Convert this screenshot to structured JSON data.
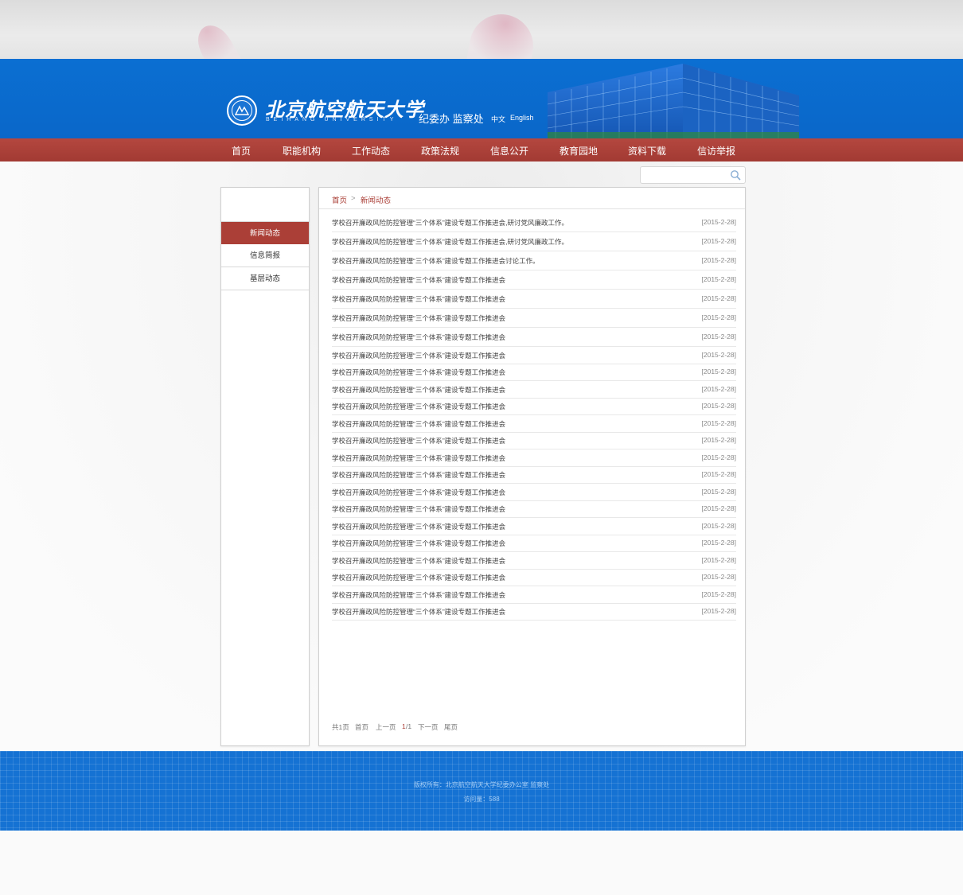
{
  "header": {
    "university_cn": "北京航空航天大学",
    "university_en": "BEIHANG UNIVERSITY",
    "org_name": "纪委办 监察处",
    "lang_cn": "中文",
    "lang_en": "English"
  },
  "nav": {
    "items": [
      "首页",
      "职能机构",
      "工作动态",
      "政策法规",
      "信息公开",
      "教育园地",
      "资料下载",
      "信访举报"
    ]
  },
  "search": {
    "placeholder": "",
    "icon": "search-icon"
  },
  "sidebar": {
    "items": [
      {
        "label": "新闻动态",
        "active": true
      },
      {
        "label": "信息简报",
        "active": false
      },
      {
        "label": "基层动态",
        "active": false
      }
    ]
  },
  "breadcrumb": {
    "home": "首页",
    "sep": ">",
    "current": "新闻动态"
  },
  "news": [
    {
      "title": "学校召开廉政风险防控管理“三个体系”建设专题工作推进会,研讨党风廉政工作。",
      "date": "[2015-2-28]"
    },
    {
      "title": "学校召开廉政风险防控管理“三个体系”建设专题工作推进会,研讨党风廉政工作。",
      "date": "[2015-2-28]"
    },
    {
      "title": "学校召开廉政风险防控管理“三个体系”建设专题工作推进会讨论工作。",
      "date": "[2015-2-28]"
    },
    {
      "title": "学校召开廉政风险防控管理“三个体系”建设专题工作推进会",
      "date": "[2015-2-28]"
    },
    {
      "title": "学校召开廉政风险防控管理“三个体系”建设专题工作推进会",
      "date": "[2015-2-28]"
    },
    {
      "title": "学校召开廉政风险防控管理“三个体系”建设专题工作推进会",
      "date": "[2015-2-28]"
    },
    {
      "title": "学校召开廉政风险防控管理“三个体系”建设专题工作推进会",
      "date": "[2015-2-28]"
    },
    {
      "title": "学校召开廉政风险防控管理“三个体系”建设专题工作推进会",
      "date": "[2015-2-28]"
    },
    {
      "title": "学校召开廉政风险防控管理“三个体系”建设专题工作推进会",
      "date": "[2015-2-28]"
    },
    {
      "title": "学校召开廉政风险防控管理“三个体系”建设专题工作推进会",
      "date": "[2015-2-28]"
    },
    {
      "title": "学校召开廉政风险防控管理“三个体系”建设专题工作推进会",
      "date": "[2015-2-28]"
    },
    {
      "title": "学校召开廉政风险防控管理“三个体系”建设专题工作推进会",
      "date": "[2015-2-28]"
    },
    {
      "title": "学校召开廉政风险防控管理“三个体系”建设专题工作推进会",
      "date": "[2015-2-28]"
    },
    {
      "title": "学校召开廉政风险防控管理“三个体系”建设专题工作推进会",
      "date": "[2015-2-28]"
    },
    {
      "title": "学校召开廉政风险防控管理“三个体系”建设专题工作推进会",
      "date": "[2015-2-28]"
    },
    {
      "title": "学校召开廉政风险防控管理“三个体系”建设专题工作推进会",
      "date": "[2015-2-28]"
    },
    {
      "title": "学校召开廉政风险防控管理“三个体系”建设专题工作推进会",
      "date": "[2015-2-28]"
    },
    {
      "title": "学校召开廉政风险防控管理“三个体系”建设专题工作推进会",
      "date": "[2015-2-28]"
    },
    {
      "title": "学校召开廉政风险防控管理“三个体系”建设专题工作推进会",
      "date": "[2015-2-28]"
    },
    {
      "title": "学校召开廉政风险防控管理“三个体系”建设专题工作推进会",
      "date": "[2015-2-28]"
    },
    {
      "title": "学校召开廉政风险防控管理“三个体系”建设专题工作推进会",
      "date": "[2015-2-28]"
    },
    {
      "title": "学校召开廉政风险防控管理“三个体系”建设专题工作推进会",
      "date": "[2015-2-28]"
    },
    {
      "title": "学校召开廉政风险防控管理“三个体系”建设专题工作推进会",
      "date": "[2015-2-28]"
    }
  ],
  "pager": {
    "total": "共1页",
    "first": "首页",
    "prev": "上一页",
    "current": "1",
    "slash_total": "/1",
    "next": "下一页",
    "last": "尾页"
  },
  "footer": {
    "copyright": "版权所有：北京航空航天大学纪委办公室 监察处",
    "visits": "访问量：588"
  },
  "colors": {
    "header_blue": "#0b6fd2",
    "nav_red": "#a93c34",
    "footer_blue": "#1572d3"
  }
}
